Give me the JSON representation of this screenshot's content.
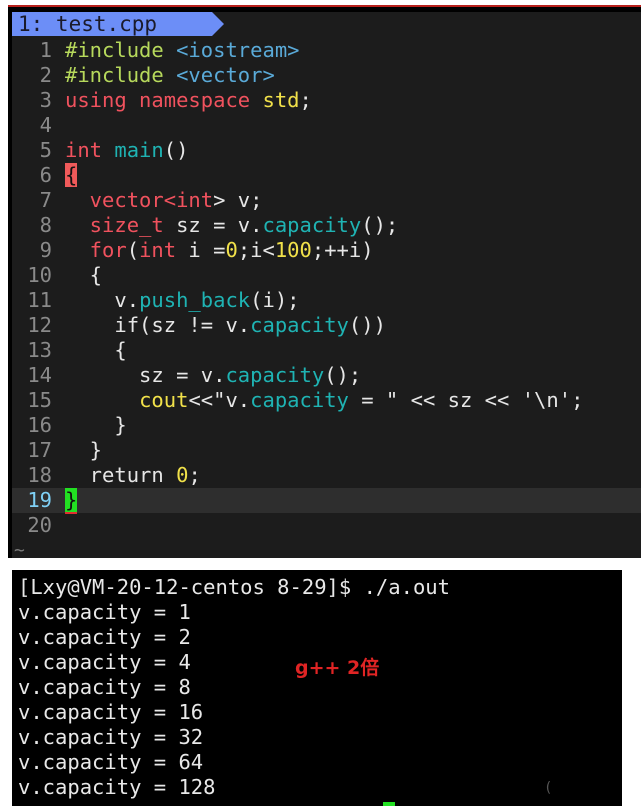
{
  "editor": {
    "tab_label": "1: test.cpp",
    "current_line": 19,
    "empty_line_marker": "~",
    "lines": [
      {
        "n": "1",
        "segs": [
          {
            "t": "#include ",
            "c": "k-inc"
          },
          {
            "t": "<iostream>",
            "c": "k-str"
          }
        ]
      },
      {
        "n": "2",
        "segs": [
          {
            "t": "#include ",
            "c": "k-inc"
          },
          {
            "t": "<vector>",
            "c": "k-str"
          }
        ]
      },
      {
        "n": "3",
        "segs": [
          {
            "t": "using namespace ",
            "c": "k-red"
          },
          {
            "t": "std",
            "c": "k-yel"
          },
          {
            "t": ";",
            "c": "k-pl"
          }
        ]
      },
      {
        "n": "4",
        "segs": []
      },
      {
        "n": "5",
        "segs": [
          {
            "t": "int ",
            "c": "k-red"
          },
          {
            "t": "main",
            "c": "k-fn"
          },
          {
            "t": "()",
            "c": "k-pl"
          }
        ]
      },
      {
        "n": "6",
        "segs": [
          {
            "t": "{",
            "c": "brace-red"
          }
        ]
      },
      {
        "n": "7",
        "segs": [
          {
            "t": "  vector<",
            "c": "k-red"
          },
          {
            "t": "int",
            "c": "k-red"
          },
          {
            "t": "> v;",
            "c": "k-pl"
          }
        ]
      },
      {
        "n": "8",
        "segs": [
          {
            "t": "  size_t",
            "c": "k-red"
          },
          {
            "t": " sz = v.",
            "c": "k-pl"
          },
          {
            "t": "capacity",
            "c": "k-fn"
          },
          {
            "t": "();",
            "c": "k-pl"
          }
        ]
      },
      {
        "n": "9",
        "segs": [
          {
            "t": "  for",
            "c": "k-red"
          },
          {
            "t": "(",
            "c": "k-pl"
          },
          {
            "t": "int",
            "c": "k-red"
          },
          {
            "t": " i =",
            "c": "k-pl"
          },
          {
            "t": "0",
            "c": "k-yel"
          },
          {
            "t": ";i<",
            "c": "k-pl"
          },
          {
            "t": "100",
            "c": "k-yel"
          },
          {
            "t": ";++i)",
            "c": "k-pl"
          }
        ]
      },
      {
        "n": "10",
        "segs": [
          {
            "t": "  {",
            "c": "k-pl"
          }
        ]
      },
      {
        "n": "11",
        "segs": [
          {
            "t": "    v.",
            "c": "k-pl"
          },
          {
            "t": "push_back",
            "c": "k-fn"
          },
          {
            "t": "(i);",
            "c": "k-pl"
          }
        ]
      },
      {
        "n": "12",
        "segs": [
          {
            "t": "    if(sz != v.",
            "c": "k-pl"
          },
          {
            "t": "capacity",
            "c": "k-fn"
          },
          {
            "t": "())",
            "c": "k-pl"
          }
        ]
      },
      {
        "n": "13",
        "segs": [
          {
            "t": "    {",
            "c": "k-pl"
          }
        ]
      },
      {
        "n": "14",
        "segs": [
          {
            "t": "      sz = v.",
            "c": "k-pl"
          },
          {
            "t": "capacity",
            "c": "k-fn"
          },
          {
            "t": "();",
            "c": "k-pl"
          }
        ]
      },
      {
        "n": "15",
        "segs": [
          {
            "t": "      ",
            "c": "k-pl"
          },
          {
            "t": "cout",
            "c": "k-yel"
          },
          {
            "t": "<<\"v.",
            "c": "k-pl"
          },
          {
            "t": "capacity",
            "c": "k-fn"
          },
          {
            "t": " = \" << sz << '\\n';",
            "c": "k-pl"
          }
        ]
      },
      {
        "n": "16",
        "segs": [
          {
            "t": "    }",
            "c": "k-pl"
          }
        ]
      },
      {
        "n": "17",
        "segs": [
          {
            "t": "  }",
            "c": "k-pl"
          }
        ]
      },
      {
        "n": "18",
        "segs": [
          {
            "t": "  return ",
            "c": "k-pl"
          },
          {
            "t": "0",
            "c": "k-yel"
          },
          {
            "t": ";",
            "c": "k-pl"
          }
        ]
      },
      {
        "n": "19",
        "segs": [
          {
            "t": "}",
            "c": "brace-grn"
          }
        ]
      },
      {
        "n": "20",
        "segs": []
      }
    ]
  },
  "terminal": {
    "prompt": "[Lxy@VM-20-12-centos 8-29]$ ./a.out",
    "output": [
      "v.capacity = 1",
      "v.capacity = 2",
      "v.capacity = 4",
      "v.capacity = 8",
      "v.capacity = 16",
      "v.capacity = 32",
      "v.capacity = 64",
      "v.capacity = 128"
    ],
    "annotation": "g++ 2倍",
    "annotation_color": "#e02424"
  },
  "colors": {
    "tab_bg": "#6c8ef7",
    "editor_bg": "#1c1c1c",
    "terminal_bg": "#000000",
    "accent_border": "#b8201c"
  }
}
